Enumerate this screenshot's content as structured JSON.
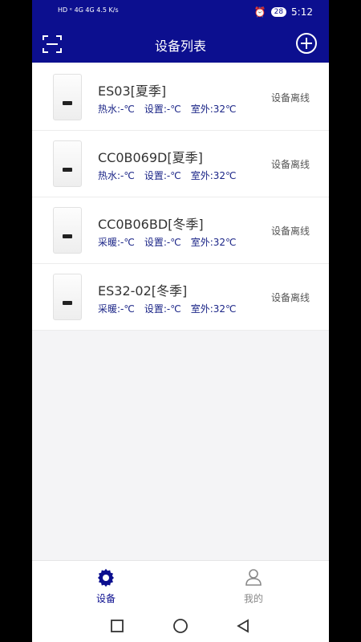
{
  "status_bar": {
    "left_text": "HD ᵉ  4G  4G  4.5 K/s",
    "battery": "28",
    "time": "5:12"
  },
  "header": {
    "title": "设备列表"
  },
  "devices": [
    {
      "name": "ES03[夏季]",
      "mode_label": "热水:-℃",
      "set_label": "设置:-℃",
      "outdoor_label": "室外:32℃",
      "status": "设备离线"
    },
    {
      "name": "CC0B069D[夏季]",
      "mode_label": "热水:-℃",
      "set_label": "设置:-℃",
      "outdoor_label": "室外:32℃",
      "status": "设备离线"
    },
    {
      "name": "CC0B06BD[冬季]",
      "mode_label": "采暖:-℃",
      "set_label": "设置:-℃",
      "outdoor_label": "室外:32℃",
      "status": "设备离线"
    },
    {
      "name": "ES32-02[冬季]",
      "mode_label": "采暖:-℃",
      "set_label": "设置:-℃",
      "outdoor_label": "室外:32℃",
      "status": "设备离线"
    }
  ],
  "bottom_nav": {
    "devices_label": "设备",
    "mine_label": "我的"
  },
  "colors": {
    "brand": "#0c0f8f",
    "meta_text": "#1b2587",
    "background": "#f4f4f6"
  }
}
